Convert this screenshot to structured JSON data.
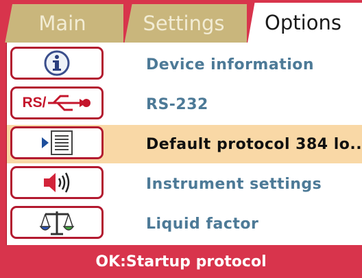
{
  "tabs": [
    {
      "label": "Main"
    },
    {
      "label": "Settings"
    },
    {
      "label": "Options"
    }
  ],
  "active_tab": "Options",
  "menu_items": [
    {
      "label": "Device information",
      "icon": "info-icon"
    },
    {
      "label": "RS-232",
      "icon": "rs232-usb-icon",
      "icon_text": "RS/"
    },
    {
      "label": "Default protocol 384 lo...",
      "icon": "protocol-list-icon",
      "selected": true
    },
    {
      "label": "Instrument settings",
      "icon": "speaker-icon"
    },
    {
      "label": "Liquid factor",
      "icon": "balance-scale-icon"
    }
  ],
  "status": {
    "text": "OK:Startup protocol"
  },
  "colors": {
    "frame": "#d8344c",
    "inactive_tab": "#c9b67c",
    "selected_row": "#f9d8a6",
    "label": "#4d7a97"
  }
}
